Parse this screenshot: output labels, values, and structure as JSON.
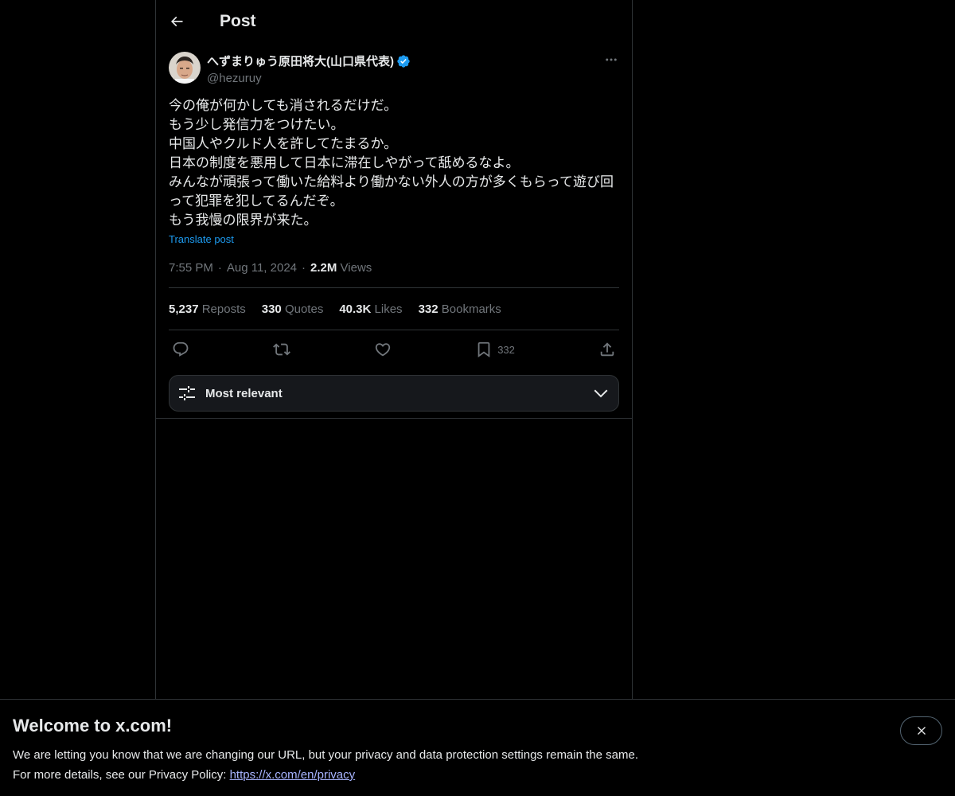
{
  "header": {
    "title": "Post",
    "back_icon": "arrow-left-icon"
  },
  "post": {
    "author": {
      "display_name": "へずまりゅう原田将大(山口県代表)",
      "handle": "@hezuruy",
      "verified": true,
      "verified_color": "#1d9bf0"
    },
    "lines": [
      "今の俺が何かしても消されるだけだ。",
      "もう少し発信力をつけたい。",
      "中国人やクルド人を許してたまるか。",
      "日本の制度を悪用して日本に滞在しやがって舐めるなよ。",
      "みんなが頑張って働いた給料より働かない外人の方が多くもらって遊び回",
      "って犯罪を犯してるんだぞ。",
      "もう我慢の限界が来た。"
    ],
    "translate_label": "Translate post",
    "time": "7:55 PM",
    "date": "Aug 11, 2024",
    "separator": "·",
    "views_count": "2.2M",
    "views_label": "Views"
  },
  "stats": [
    {
      "count": "5,237",
      "label": "Reposts"
    },
    {
      "count": "330",
      "label": "Quotes"
    },
    {
      "count": "40.3K",
      "label": "Likes"
    },
    {
      "count": "332",
      "label": "Bookmarks"
    }
  ],
  "actions": {
    "reply_icon": "reply-icon",
    "repost_icon": "repost-icon",
    "like_icon": "heart-icon",
    "bookmark_icon": "bookmark-icon",
    "bookmark_count": "332",
    "share_icon": "share-icon"
  },
  "sort": {
    "label": "Most relevant",
    "icon": "sliders-icon",
    "chevron": "chevron-down-icon"
  },
  "banner": {
    "title": "Welcome to x.com!",
    "line1": "We are letting you know that we are changing our URL, but your privacy and data protection settings remain the same.",
    "line2_prefix": "For more details, see our Privacy Policy: ",
    "link": "https://x.com/en/privacy",
    "close_icon": "close-icon"
  },
  "colors": {
    "background": "#000000",
    "text": "#e7e9ea",
    "muted": "#71767b",
    "accent": "#1d9bf0",
    "border": "#2f3336"
  }
}
